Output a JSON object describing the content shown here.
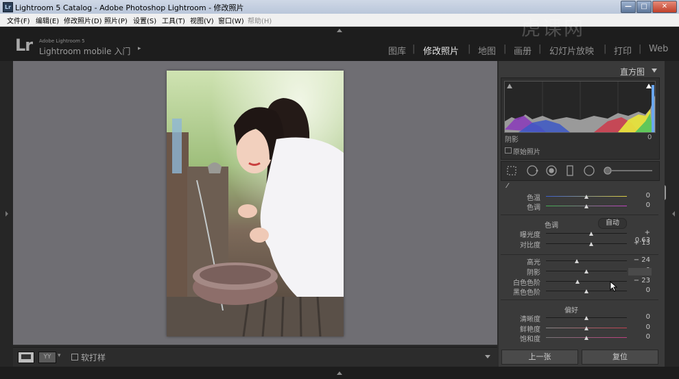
{
  "window": {
    "title": "Lightroom 5 Catalog - Adobe Photoshop Lightroom - 修改照片",
    "icon_text": "Lr",
    "buttons": {
      "minimize": "—",
      "maximize": "□",
      "close": "✕"
    }
  },
  "menubar": [
    {
      "label": "文件(F)"
    },
    {
      "label": "编辑(E)"
    },
    {
      "label": "修改照片(D)"
    },
    {
      "label": "照片(P)"
    },
    {
      "label": "设置(S)"
    },
    {
      "label": "工具(T)"
    },
    {
      "label": "视图(V)"
    },
    {
      "label": "窗口(W)"
    },
    {
      "label": "帮助(H)",
      "dim": true
    }
  ],
  "identity": {
    "logo": "Lr",
    "product": "Adobe Lightroom 5",
    "subtitle": "Lightroom mobile 入门",
    "arrow": "▸"
  },
  "modules": [
    {
      "label": "图库",
      "active": false
    },
    {
      "label": "修改照片",
      "active": true
    },
    {
      "label": "地图",
      "active": false
    },
    {
      "label": "画册",
      "active": false
    },
    {
      "label": "幻灯片放映",
      "active": false
    },
    {
      "label": "打印",
      "active": false
    },
    {
      "label": "Web",
      "active": false
    }
  ],
  "watermark": "虎课网",
  "toolbar": {
    "soft_proof": "软打样",
    "compare": "YY",
    "dropdown": "▾"
  },
  "histogram": {
    "title": "直方图",
    "info_label": "阴影",
    "info_value": "0",
    "original_label": "原始照片"
  },
  "basic": {
    "tone_header": "色调",
    "auto_button": "自动",
    "presence_header": "偏好",
    "sliders": [
      {
        "id": "temp",
        "label": "色温",
        "value": "0",
        "pos": 0.5
      },
      {
        "id": "tint",
        "label": "色调",
        "value": "0",
        "pos": 0.5
      },
      {
        "id": "exposure",
        "label": "曝光度",
        "value": "+ 0.63",
        "pos": 0.56
      },
      {
        "id": "contrast",
        "label": "对比度",
        "value": "+ 13",
        "pos": 0.56
      },
      {
        "id": "highlights",
        "label": "高光",
        "value": "− 24",
        "pos": 0.38
      },
      {
        "id": "shadows",
        "label": "阴影",
        "value": "0",
        "pos": 0.5
      },
      {
        "id": "whites",
        "label": "白色色阶",
        "value": "− 23",
        "pos": 0.39
      },
      {
        "id": "blacks",
        "label": "黑色色阶",
        "value": "0",
        "pos": 0.5
      },
      {
        "id": "clarity",
        "label": "清晰度",
        "value": "0",
        "pos": 0.5
      },
      {
        "id": "vibrance",
        "label": "鲜艳度",
        "value": "0",
        "pos": 0.5
      },
      {
        "id": "saturation",
        "label": "饱和度",
        "value": "0",
        "pos": 0.5
      }
    ]
  },
  "buttons": {
    "previous": "上一张",
    "reset": "复位"
  },
  "colors": {
    "panel": "#3a3a3a",
    "canvas": "#6f6e73",
    "topbar": "#1d1d1d",
    "active_module": "#e8e8e8"
  }
}
